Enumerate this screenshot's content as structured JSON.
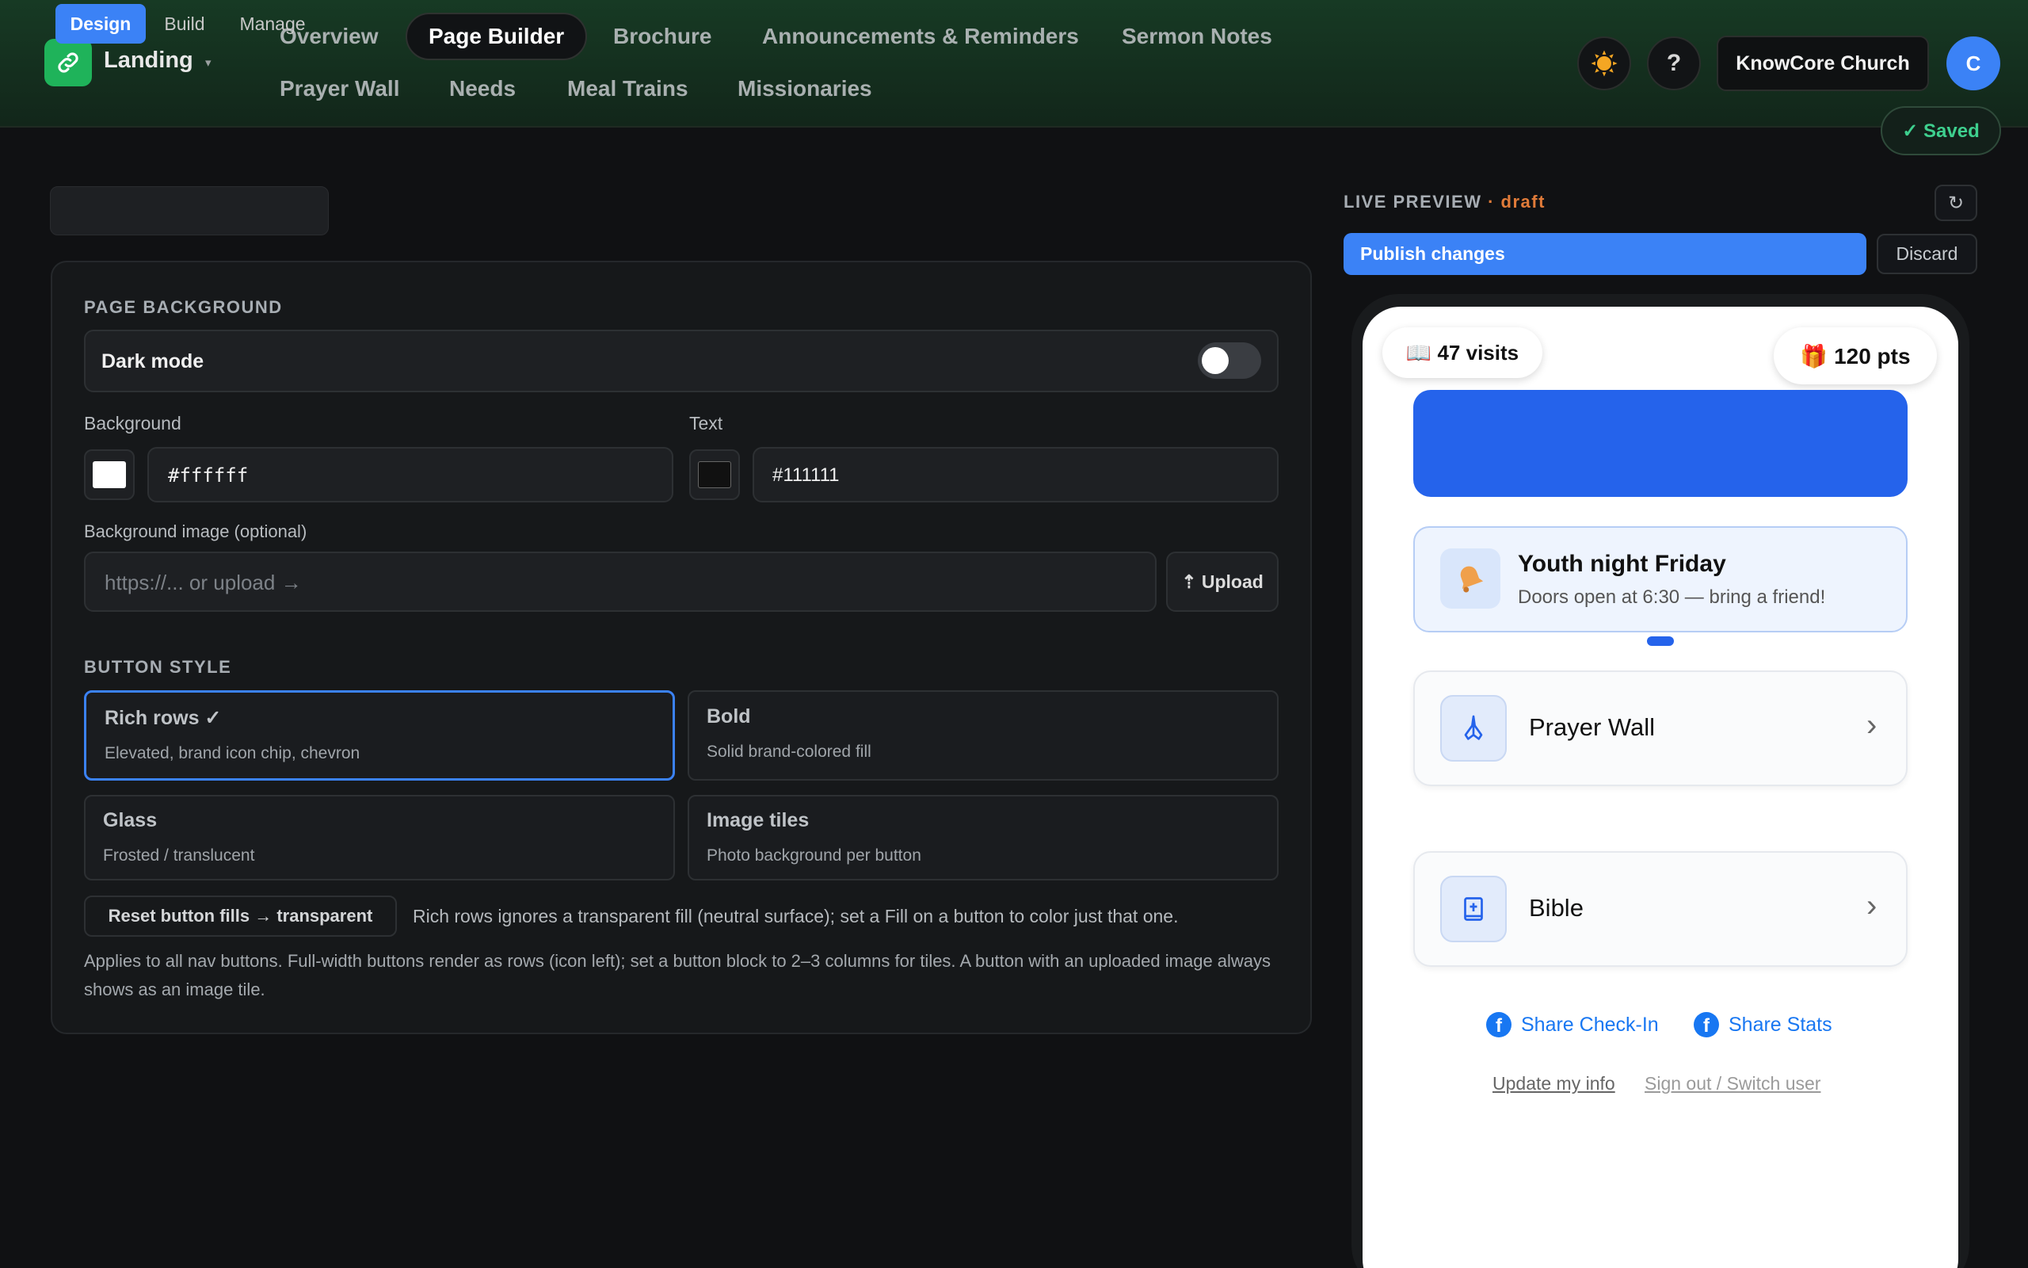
{
  "app": {
    "title": "Landing",
    "caret": "▾",
    "logo_icon": "link-icon"
  },
  "nav": {
    "items": [
      "Overview",
      "Page Builder",
      "Brochure",
      "Announcements & Reminders",
      "Sermon Notes",
      "Prayer Wall",
      "Needs",
      "Meal Trains",
      "Missionaries"
    ],
    "active": "Page Builder"
  },
  "header": {
    "theme_icon": "sun-icon",
    "help": "?",
    "church": "KnowCore Church",
    "avatar": "C",
    "saved": "✓ Saved"
  },
  "tabs": [
    "Design",
    "Build",
    "Manage"
  ],
  "design": {
    "page_background": {
      "title": "PAGE BACKGROUND",
      "dark_mode_label": "Dark mode",
      "dark_mode_on": false,
      "background_label": "Background",
      "background_value": "#ffffff",
      "text_label": "Text",
      "text_value": "#111111",
      "image_label": "Background image (optional)",
      "image_placeholder": "https://... or upload →",
      "upload": "⇡ Upload"
    },
    "button_style": {
      "title": "BUTTON STYLE",
      "options": [
        {
          "title": "Rich rows ✓",
          "sub": "Elevated, brand icon chip, chevron",
          "selected": true
        },
        {
          "title": "Bold",
          "sub": "Solid brand-colored fill"
        },
        {
          "title": "Glass",
          "sub": "Frosted / translucent"
        },
        {
          "title": "Image tiles",
          "sub": "Photo background per button"
        }
      ],
      "reset": "Reset button fills → transparent",
      "reset_note": "Rich rows ignores a transparent fill (neutral surface); set a Fill on a button to color just that one.",
      "applies": "Applies to all nav buttons. Full-width buttons render as rows (icon left); set a button block to 2–3 columns for tiles. A button with an uploaded image always shows as an image tile."
    }
  },
  "preview": {
    "label": "LIVE PREVIEW",
    "status": "· draft",
    "refresh": "↻",
    "publish": "Publish changes",
    "discard": "Discard",
    "visits": "📖 47 visits",
    "points": "🎁 120 pts",
    "announcement": {
      "icon": "bell-icon",
      "title": "Youth night Friday",
      "sub": "Doors open at 6:30 — bring a friend!"
    },
    "buttons": [
      {
        "label": "Prayer Wall",
        "icon": "praying-hands-icon"
      },
      {
        "label": "Bible",
        "icon": "bible-icon"
      }
    ],
    "chevron": "›",
    "share": [
      "Share Check-In",
      "Share Stats"
    ],
    "links": [
      "Update my info",
      "Sign out / Switch user"
    ]
  },
  "colors": {
    "accent": "#3b82f6",
    "saved": "#3ecf8e",
    "draft": "#e07b39",
    "logo": "#1fb35a",
    "facebook": "#1877f2"
  }
}
